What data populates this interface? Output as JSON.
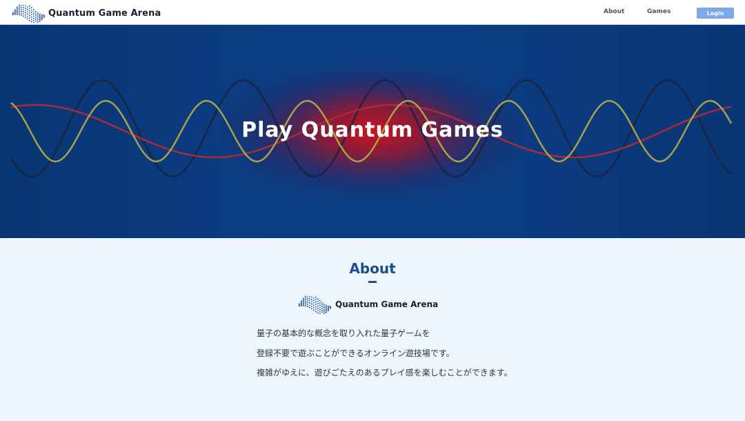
{
  "navbar": {
    "brand_name": "Quantum Game Arena",
    "links": [
      {
        "label": "About"
      },
      {
        "label": "Games"
      }
    ],
    "login_label": "Login"
  },
  "hero": {
    "title": "Play Quantum Games",
    "colors": {
      "background": "#0a3b7f",
      "glow": "#c0141e",
      "wave_yellow": "#a9a24a",
      "wave_red": "#b22a36",
      "wave_dark": "#1a2340"
    }
  },
  "about": {
    "heading": "About",
    "brand_name": "Quantum Game Arena",
    "lines": [
      "量子の基本的な概念を取り入れた量子ゲームを",
      "登録不要で遊ぶことができるオンライン遊技場です。",
      "複雑がゆえに、遊びごたえのあるプレイ感を楽しむことができます。"
    ]
  },
  "colors": {
    "accent": "#1b4e8c",
    "login_button": "#7fa8e8",
    "page_background": "#eef5fd"
  },
  "icons": {
    "logo": "quantum-wave-dot-logo"
  }
}
